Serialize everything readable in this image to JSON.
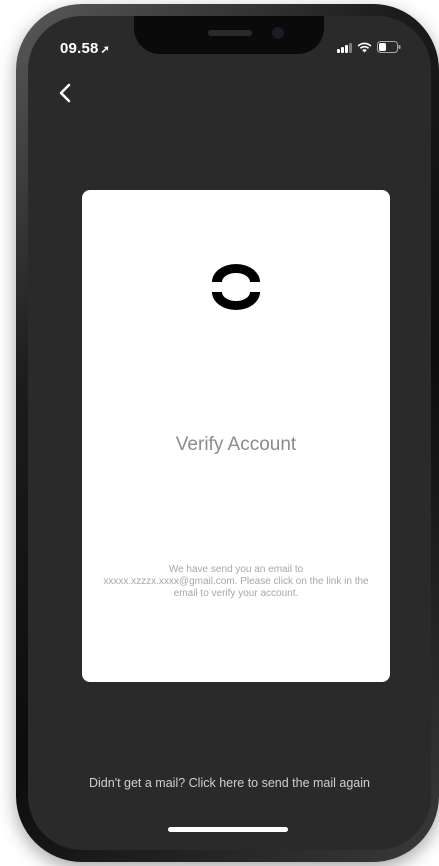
{
  "status_bar": {
    "time": "09.58",
    "location_arrow": "➚"
  },
  "card": {
    "title": "Verify Account",
    "message": "We have send you an email to xxxxx.xzzzx.xxxx@gmail.com. Please click on the link in the email to verify your account."
  },
  "footer": {
    "resend_text": "Didn't get a mail? Click here to send the mail again"
  },
  "colors": {
    "screen_background": "#2a2a2a",
    "card_background": "#ffffff",
    "title_text": "#8c8c8c",
    "footer_text": "#cfcfcf"
  },
  "icons": [
    "back-chevron-icon",
    "signal-icon",
    "wifi-icon",
    "battery-icon",
    "brand-logo"
  ]
}
